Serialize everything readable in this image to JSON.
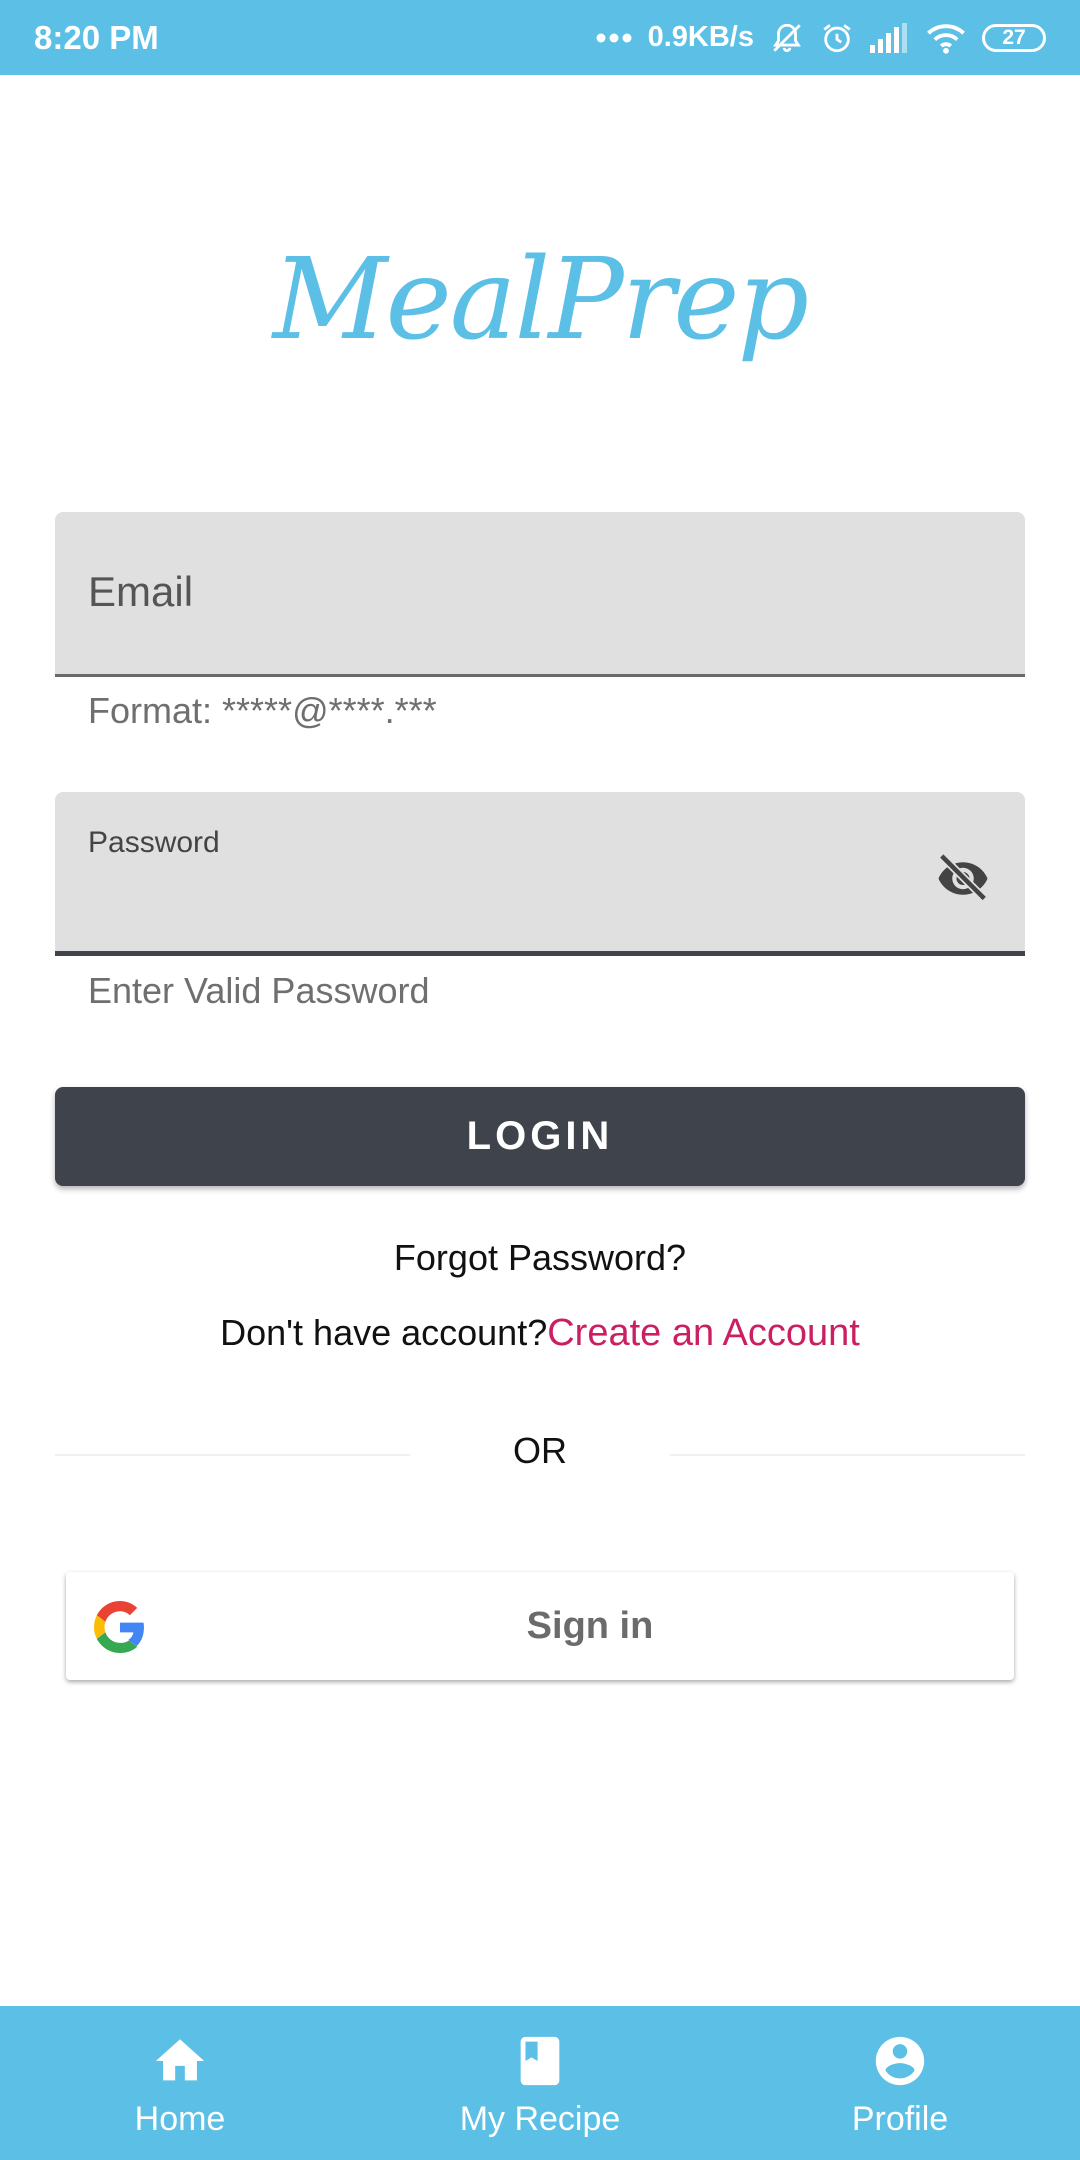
{
  "status_bar": {
    "time": "8:20 PM",
    "network_speed": "0.9KB/s",
    "battery": "27",
    "icons": [
      "dots-icon",
      "mute-bell-icon",
      "alarm-icon",
      "signal-icon",
      "wifi-icon",
      "battery-icon"
    ]
  },
  "app": {
    "logo_text": "MealPrep"
  },
  "email_field": {
    "placeholder": "Email",
    "helper": "Format: *****@****.***"
  },
  "password_field": {
    "label": "Password",
    "helper": "Enter Valid Password",
    "toggle_icon": "visibility-off-icon"
  },
  "login_button": {
    "label": "LOGIN"
  },
  "links": {
    "forgot_password": "Forgot Password?",
    "signup_prompt": "Don't have account?",
    "signup_link": "Create an Account"
  },
  "divider": {
    "text": "OR"
  },
  "google_button": {
    "label": "Sign in",
    "icon": "google-icon"
  },
  "bottom_nav": {
    "items": [
      {
        "label": "Home",
        "icon": "home-icon"
      },
      {
        "label": "My Recipe",
        "icon": "book-icon"
      },
      {
        "label": "Profile",
        "icon": "account-circle-icon"
      }
    ]
  },
  "colors": {
    "accent": "#5bbfe6",
    "dark_button": "#3f434b",
    "link": "#cc1f63",
    "field_bg": "#e0e0e0"
  }
}
